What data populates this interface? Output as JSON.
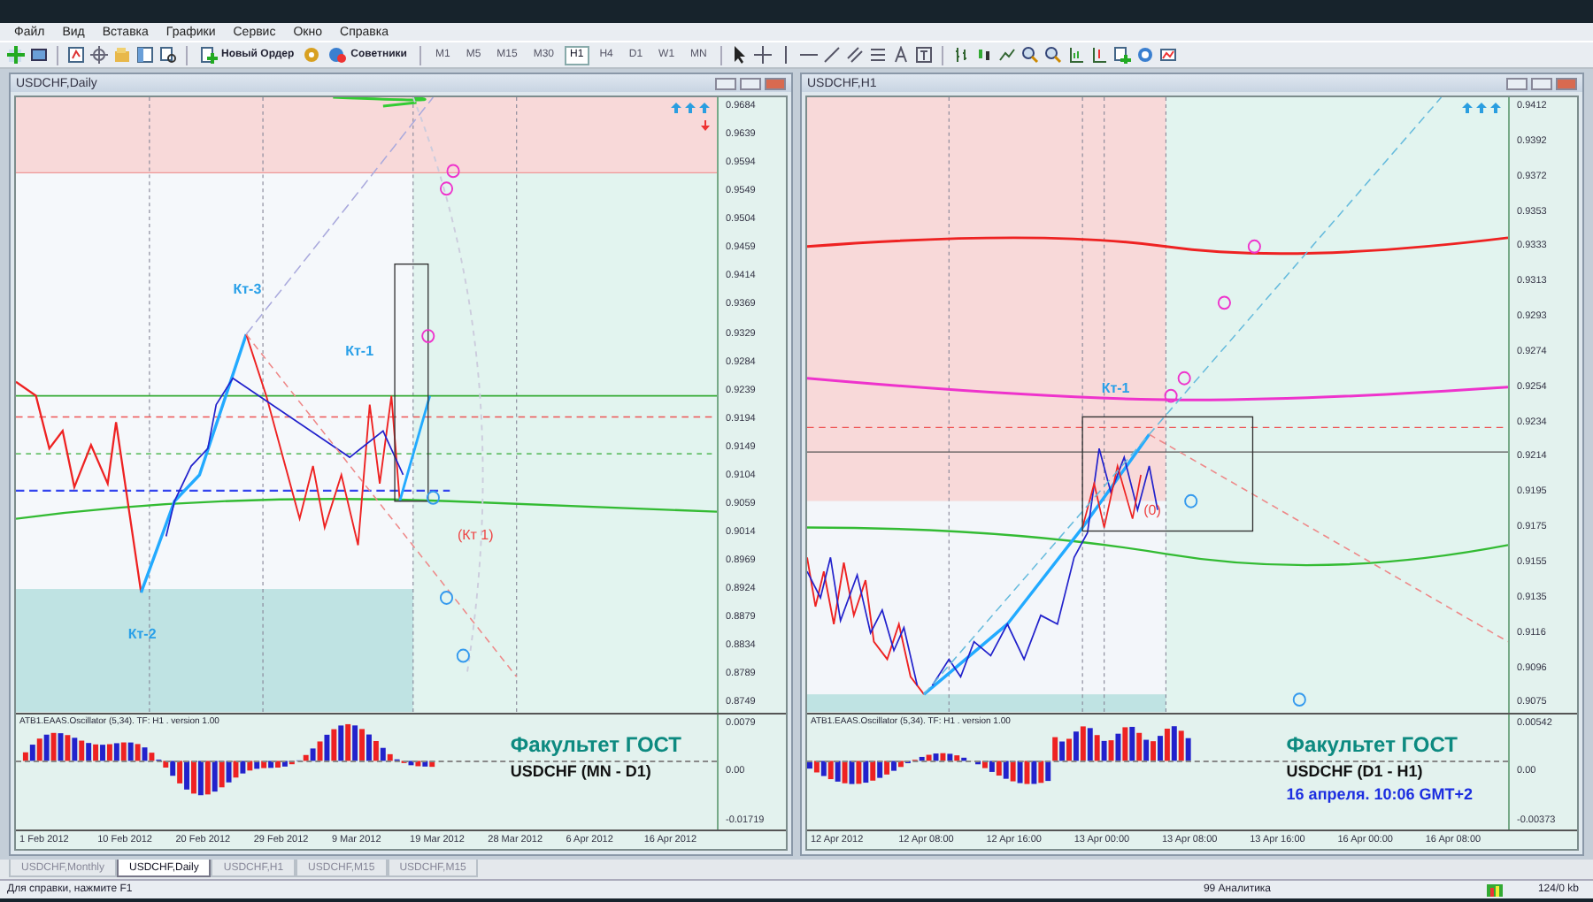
{
  "menu": [
    "Файл",
    "Вид",
    "Вставка",
    "Графики",
    "Сервис",
    "Окно",
    "Справка"
  ],
  "toolbar": {
    "new_order": "Новый Ордер",
    "experts": "Советники",
    "timeframes": [
      {
        "label": "M1",
        "selected": false
      },
      {
        "label": "M5",
        "selected": false
      },
      {
        "label": "M15",
        "selected": false
      },
      {
        "label": "M30",
        "selected": false
      },
      {
        "label": "H1",
        "selected": true
      },
      {
        "label": "H4",
        "selected": false
      },
      {
        "label": "D1",
        "selected": false
      },
      {
        "label": "W1",
        "selected": false
      },
      {
        "label": "MN",
        "selected": false
      }
    ]
  },
  "charts": [
    {
      "title": "USDCHF,Daily",
      "price_ticks": [
        "0.9684",
        "0.9639",
        "0.9594",
        "0.9549",
        "0.9504",
        "0.9459",
        "0.9414",
        "0.9369",
        "0.9329",
        "0.9284",
        "0.9239",
        "0.9194",
        "0.9149",
        "0.9104",
        "0.9059",
        "0.9014",
        "0.8969",
        "0.8924",
        "0.8879",
        "0.8834",
        "0.8789",
        "0.8749"
      ],
      "wave_labels": [
        "Кт-3",
        "Кт-2",
        "Кт-1",
        "(Кт 1)"
      ],
      "oscillator": {
        "label": "ATB1.EAAS.Oscillator (5,34). TF: H1 . version 1.00",
        "ticks": [
          "0.0079",
          "0.00",
          "-0.01719"
        ]
      },
      "caption": [
        "Факультет ГОСТ",
        "USDCHF (MN - D1)"
      ],
      "date_ticks": [
        "1 Feb 2012",
        "10 Feb 2012",
        "20 Feb 2012",
        "29 Feb 2012",
        "9 Mar 2012",
        "19 Mar 2012",
        "28 Mar 2012",
        "6 Apr 2012",
        "16 Apr 2012"
      ]
    },
    {
      "title": "USDCHF,H1",
      "price_ticks": [
        "0.9412",
        "0.9392",
        "0.9372",
        "0.9353",
        "0.9333",
        "0.9313",
        "0.9293",
        "0.9274",
        "0.9254",
        "0.9234",
        "0.9214",
        "0.9195",
        "0.9175",
        "0.9155",
        "0.9135",
        "0.9116",
        "0.9096",
        "0.9075"
      ],
      "wave_labels": [
        "Кт-1",
        "(0)"
      ],
      "oscillator": {
        "label": "ATB1.EAAS.Oscillator (5,34). TF: H1 . version 1.00",
        "ticks": [
          "0.00542",
          "0.00",
          "-0.00373"
        ]
      },
      "caption": [
        "Факультет ГОСТ",
        "USDCHF (D1 - H1)",
        "16 апреля. 10:06 GMT+2"
      ],
      "date_ticks": [
        "12 Apr 2012",
        "12 Apr 08:00",
        "12 Apr 16:00",
        "13 Apr 00:00",
        "13 Apr 08:00",
        "13 Apr 16:00",
        "16 Apr 00:00",
        "16 Apr 08:00"
      ]
    }
  ],
  "tabs": [
    {
      "label": "USDCHF,Monthly",
      "selected": false
    },
    {
      "label": "USDCHF,Daily",
      "selected": true
    },
    {
      "label": "USDCHF,H1",
      "selected": false
    },
    {
      "label": "USDCHF,M15",
      "selected": false
    },
    {
      "label": "USDCHF,M15",
      "selected": false
    }
  ],
  "status_bar": {
    "help": "Для справки, нажмите F1",
    "profile": "99 Аналитика",
    "traffic": "124/0 kb"
  }
}
